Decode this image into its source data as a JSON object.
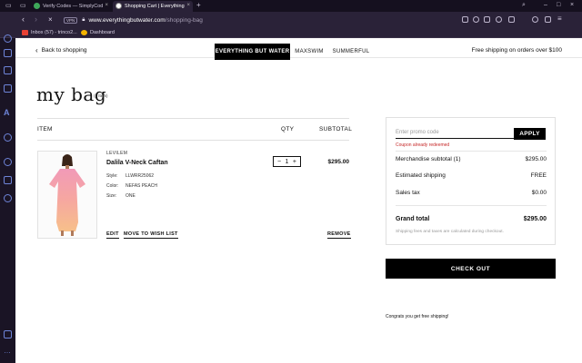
{
  "browser": {
    "tabs": [
      {
        "label": "Verify Codes — SimplyCod",
        "active": false
      },
      {
        "label": "Shopping Cart | Everything",
        "active": true
      }
    ],
    "url_host": "www.everythingbutwater.com",
    "url_path": "/shopping-bag",
    "vpn_label": "VPN",
    "bookmarks": [
      {
        "label": "Inbox (57) - trinco2..."
      },
      {
        "label": "Dashboard"
      }
    ]
  },
  "topbar": {
    "back_label": "Back to shopping",
    "brands": [
      "EVERYTHING BUT WATER",
      "MAXSWIM",
      "SUMMERFUL"
    ],
    "free_shipping": "Free shipping on orders over $100"
  },
  "bag": {
    "title": "my bag",
    "item_count": "(1 Item)",
    "columns": {
      "item": "ITEM",
      "qty": "QTY",
      "subtotal": "SUBTOTAL"
    }
  },
  "item": {
    "vendor": "LEVILEM",
    "name": "Dalila V-Neck Caftan",
    "style_label": "Style:",
    "style_value": "LLWRR25062",
    "color_label": "Color:",
    "color_value": "NEFAS PEACH",
    "size_label": "Size:",
    "size_value": "ONE",
    "qty_minus": "−",
    "qty": "1",
    "qty_plus": "+",
    "price": "$295.00",
    "edit_label": "EDIT",
    "wishlist_label": "MOVE TO WISH LIST",
    "remove_label": "REMOVE"
  },
  "summary": {
    "promo_placeholder": "Enter promo code",
    "apply_label": "APPLY",
    "coupon_error": "Coupon already redeemed",
    "merch_label": "Merchandise subtotal (1)",
    "merch_value": "$295.00",
    "shipping_label": "Estimated shipping",
    "shipping_value": "FREE",
    "tax_label": "Sales tax",
    "tax_value": "$0.00",
    "total_label": "Grand total",
    "total_value": "$295.00",
    "fees_note": "Shipping fees and taxes are calculated during checkout."
  },
  "checkout_label": "CHECK OUT",
  "congrats": "Congrats you get free shipping!",
  "colors": {
    "accent": "#000000",
    "error": "#c62828",
    "chrome": "#2a2238"
  }
}
